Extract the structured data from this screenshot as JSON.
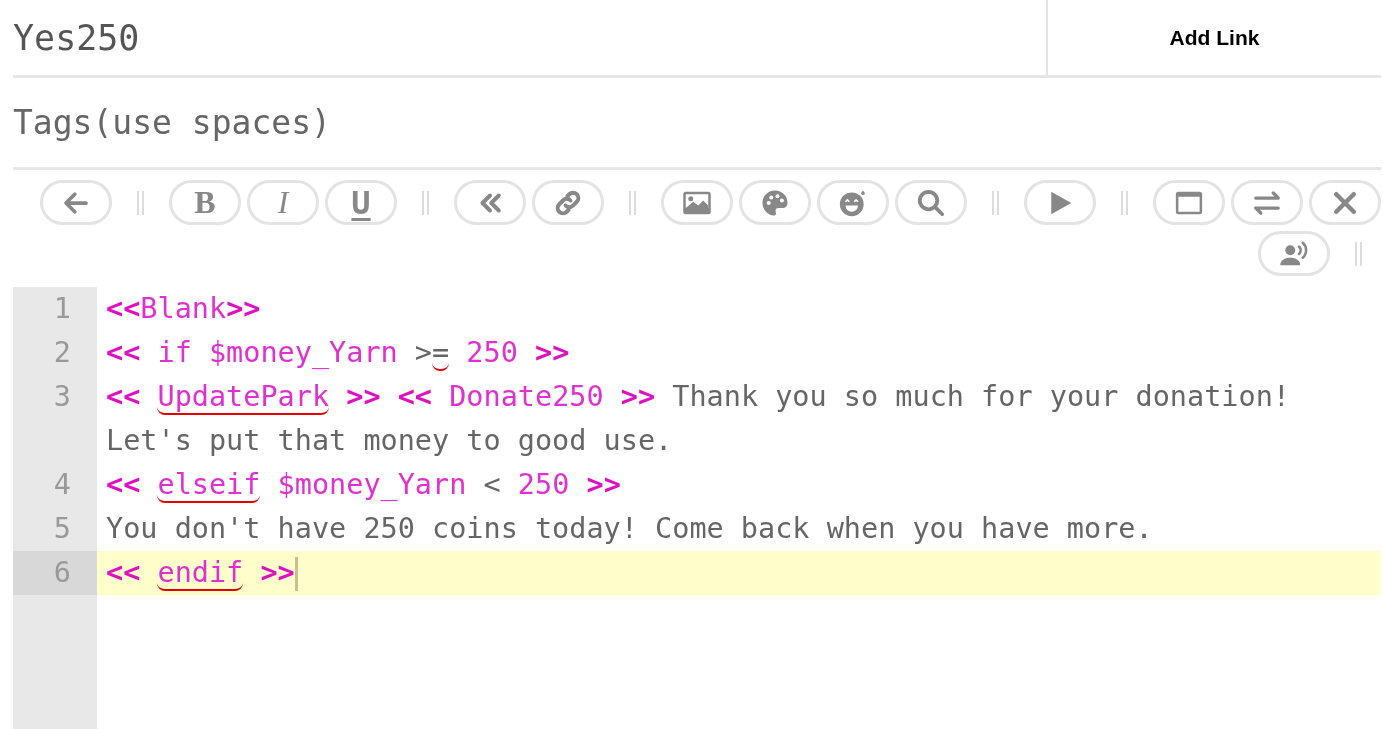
{
  "title_field": {
    "value": "Yes250"
  },
  "add_link_button": {
    "label": "Add Link"
  },
  "tags_field": {
    "placeholder": "Tags(use spaces)"
  },
  "toolbar": [
    {
      "kind": "back"
    },
    {
      "kind": "separator"
    },
    {
      "kind": "bold",
      "label": "B"
    },
    {
      "kind": "italic",
      "label": "I"
    },
    {
      "kind": "underline",
      "label": "U"
    },
    {
      "kind": "separator"
    },
    {
      "kind": "chevrons"
    },
    {
      "kind": "link"
    },
    {
      "kind": "separator"
    },
    {
      "kind": "image"
    },
    {
      "kind": "palette"
    },
    {
      "kind": "emoji"
    },
    {
      "kind": "search"
    },
    {
      "kind": "separator"
    },
    {
      "kind": "play"
    },
    {
      "kind": "separator"
    },
    {
      "kind": "window"
    },
    {
      "kind": "swap"
    },
    {
      "kind": "close"
    },
    {
      "kind": "speaker"
    },
    {
      "kind": "separator"
    }
  ],
  "editor": {
    "lines": [
      {
        "number": "1",
        "selected": false,
        "tokens": [
          {
            "text": "<<",
            "kind": "bracket",
            "misspelled": false
          },
          {
            "text": "Blank",
            "kind": "keyword",
            "misspelled": false
          },
          {
            "text": ">>",
            "kind": "bracket",
            "misspelled": false
          }
        ]
      },
      {
        "number": "2",
        "selected": false,
        "tokens": [
          {
            "text": "<< ",
            "kind": "bracket",
            "misspelled": false
          },
          {
            "text": "if $money_Yarn",
            "kind": "keyword",
            "misspelled": false
          },
          {
            "text": " >",
            "kind": "plain",
            "misspelled": false
          },
          {
            "text": "=",
            "kind": "plain",
            "misspelled": true
          },
          {
            "text": " 250",
            "kind": "keyword",
            "misspelled": false
          },
          {
            "text": " >>",
            "kind": "bracket",
            "misspelled": false
          }
        ]
      },
      {
        "number": "3",
        "selected": false,
        "tokens": [
          {
            "text": "<< ",
            "kind": "bracket",
            "misspelled": false
          },
          {
            "text": "UpdatePark",
            "kind": "keyword",
            "misspelled": true
          },
          {
            "text": " >> << ",
            "kind": "bracket",
            "misspelled": false
          },
          {
            "text": "Donate250",
            "kind": "keyword",
            "misspelled": false
          },
          {
            "text": " >> ",
            "kind": "bracket",
            "misspelled": false
          },
          {
            "text": "Thank you so much for your donation! ",
            "kind": "plain",
            "misspelled": false
          },
          {
            "text": "Let's put that money to good use.",
            "kind": "plain",
            "misspelled": false
          }
        ]
      },
      {
        "number": "4",
        "selected": false,
        "tokens": [
          {
            "text": "<< ",
            "kind": "bracket",
            "misspelled": false
          },
          {
            "text": "elseif",
            "kind": "keyword",
            "misspelled": true
          },
          {
            "text": " $money_Yarn",
            "kind": "keyword",
            "misspelled": false
          },
          {
            "text": " < ",
            "kind": "plain",
            "misspelled": false
          },
          {
            "text": "250",
            "kind": "keyword",
            "misspelled": false
          },
          {
            "text": " >>",
            "kind": "bracket",
            "misspelled": false
          }
        ]
      },
      {
        "number": "5",
        "selected": false,
        "tokens": [
          {
            "text": "You don't have 250 coins today! Come back when you have more.",
            "kind": "plain",
            "misspelled": false
          }
        ]
      },
      {
        "number": "6",
        "selected": true,
        "tokens": [
          {
            "text": "<< ",
            "kind": "bracket",
            "misspelled": false
          },
          {
            "text": "endif",
            "kind": "keyword",
            "misspelled": true
          },
          {
            "text": " >>",
            "kind": "bracket",
            "misspelled": false
          }
        ]
      }
    ]
  }
}
